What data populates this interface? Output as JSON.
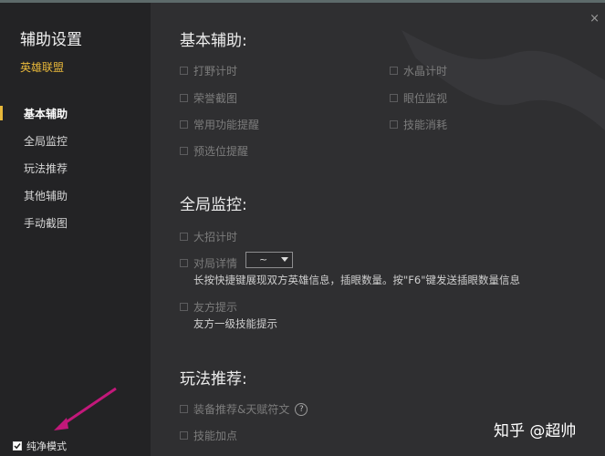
{
  "sidebar": {
    "title": "辅助设置",
    "game": "英雄联盟",
    "items": [
      {
        "label": "基本辅助",
        "active": true
      },
      {
        "label": "全局监控",
        "active": false
      },
      {
        "label": "玩法推荐",
        "active": false
      },
      {
        "label": "其他辅助",
        "active": false
      },
      {
        "label": "手动截图",
        "active": false
      }
    ]
  },
  "pure_mode": {
    "label": "纯净模式",
    "checked": true
  },
  "window": {
    "close_glyph": "×"
  },
  "sections": {
    "basic": {
      "title": "基本辅助:",
      "options": [
        "打野计时",
        "水晶计时",
        "荣誉截图",
        "眼位监视",
        "常用功能提醒",
        "技能消耗",
        "预选位提醒"
      ]
    },
    "global": {
      "title": "全局监控:",
      "options": [
        "大招计时",
        "对局详情",
        "友方提示"
      ],
      "dropdown_value": "~",
      "detail_desc": "长按快捷键展现双方英雄信息，插眼数量。按\"F6\"键发送插眼数量信息",
      "ally_desc": "友方一级技能提示"
    },
    "play": {
      "title": "玩法推荐:",
      "options": [
        "装备推荐&天赋符文",
        "技能加点"
      ]
    }
  },
  "watermark": "知乎 @超帅",
  "colors": {
    "accent": "#e8b83a",
    "sidebar_bg": "#232325",
    "main_bg": "#2f2f31",
    "arrow": "#c2187a"
  }
}
